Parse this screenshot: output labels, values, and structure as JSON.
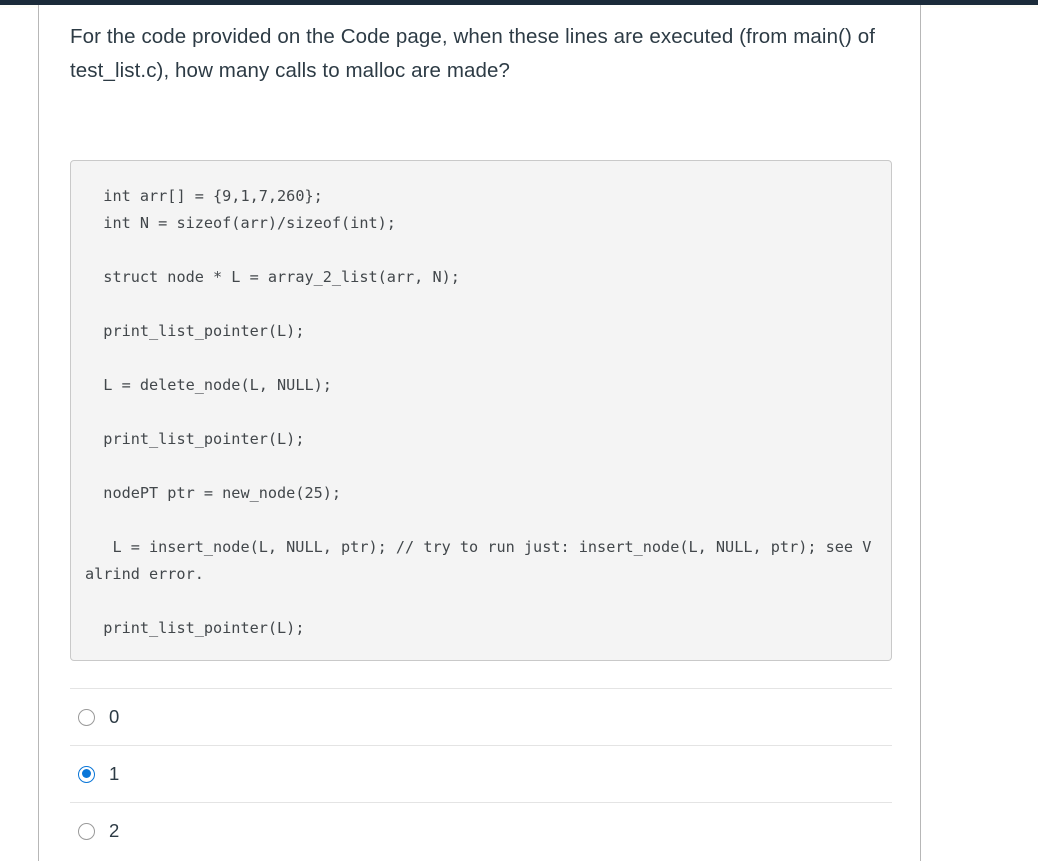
{
  "colors": {
    "top_bar": "#1b2B3A",
    "text": "#2d3b45",
    "code_background": "#f4f4f4",
    "code_border": "#c9c9c9",
    "code_text": "#42474b",
    "accent_selected": "#0a76d8",
    "divider": "#e4e4e4",
    "frame_border": "#b7b7b7"
  },
  "question": {
    "text": "For the code provided on the Code page,  when these lines are executed (from main() of test_list.c), how many calls to malloc are made?"
  },
  "code": {
    "lines": [
      "  int arr[] = {9,1,7,260};",
      "  int N = sizeof(arr)/sizeof(int);",
      "",
      "  struct node * L = array_2_list(arr, N);",
      "",
      "  print_list_pointer(L);",
      "",
      "  L = delete_node(L, NULL);",
      "",
      "  print_list_pointer(L);",
      "",
      "  nodePT ptr = new_node(25);",
      "",
      "   L = insert_node(L, NULL, ptr); // try to run just: insert_node(L, NULL, ptr); see Valrind error.",
      "",
      "  print_list_pointer(L);"
    ]
  },
  "answers": {
    "options": [
      {
        "label": "0",
        "selected": false
      },
      {
        "label": "1",
        "selected": true
      },
      {
        "label": "2",
        "selected": false
      }
    ]
  }
}
